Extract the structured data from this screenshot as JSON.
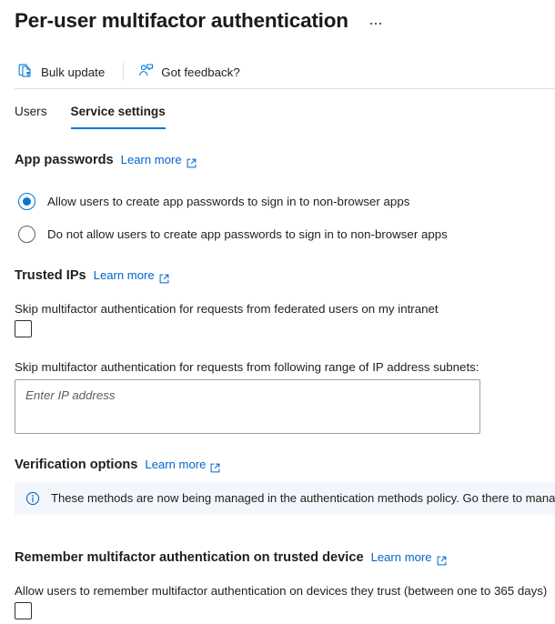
{
  "header": {
    "title": "Per-user multifactor authentication",
    "more_menu": "…"
  },
  "commandbar": {
    "bulk_update": "Bulk update",
    "got_feedback": "Got feedback?"
  },
  "tabs": [
    {
      "label": "Users",
      "active": false
    },
    {
      "label": "Service settings",
      "active": true
    }
  ],
  "links": {
    "learn_more": "Learn more"
  },
  "app_passwords": {
    "heading": "App passwords",
    "options": [
      {
        "label": "Allow users to create app passwords to sign in to non-browser apps",
        "selected": true
      },
      {
        "label": "Do not allow users to create app passwords to sign in to non-browser apps",
        "selected": false
      }
    ]
  },
  "trusted_ips": {
    "heading": "Trusted IPs",
    "federated_label": "Skip multifactor authentication for requests from federated users on my intranet",
    "federated_checked": false,
    "subnets_label": "Skip multifactor authentication for requests from following range of IP address subnets:",
    "subnets_value": "",
    "subnets_placeholder": "Enter IP address"
  },
  "verification_options": {
    "heading": "Verification options",
    "banner_text": "These methods are now being managed in the authentication methods policy. Go there to manage methods."
  },
  "remember_mfa": {
    "heading": "Remember multifactor authentication on trusted device",
    "allow_label": "Allow users to remember multifactor authentication on devices they trust (between one to 365 days)",
    "allow_checked": false
  },
  "colors": {
    "accent": "#0078d4",
    "link": "#0066cc",
    "text": "#201f1e",
    "banner_bg": "#f3f6fc",
    "divider": "#e1dfdd"
  }
}
